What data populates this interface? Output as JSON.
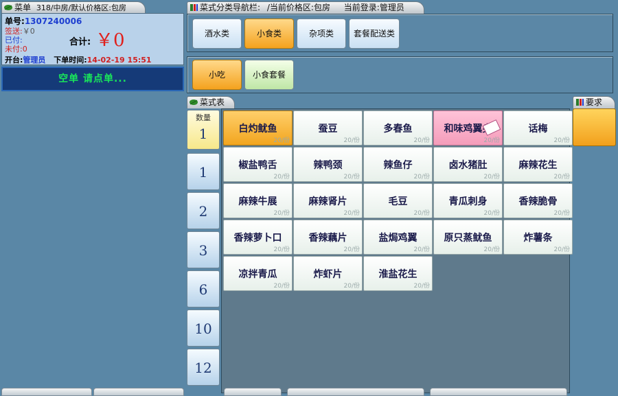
{
  "order_header": {
    "tab_label": "菜单",
    "room_info": "318/中房/默认价格区:包房"
  },
  "order_info": {
    "order_no_label": "单号:",
    "order_no": "1307240006",
    "sign_label": "签送:",
    "sign_value": "￥0",
    "paid_label": "已付:",
    "unpaid_label": "未付:",
    "unpaid_value": "0",
    "total_label": "合计:",
    "total_value": "￥0",
    "open_label": "开台:",
    "open_user": "管理员",
    "order_time_label": "下单时间:",
    "order_time": "14-02-19 15:51"
  },
  "status_message": "空单 请点单...",
  "nav": {
    "tab_label": "菜式分类导航栏:",
    "price_zone": "/当前价格区:包房",
    "login_label": "当前登录:管理员"
  },
  "categories": [
    {
      "label": "酒水类",
      "active": false
    },
    {
      "label": "小食类",
      "active": true
    },
    {
      "label": "杂项类",
      "active": false
    },
    {
      "label": "套餐配送类",
      "active": false
    }
  ],
  "subcategories": [
    {
      "label": "小吃",
      "active": true
    },
    {
      "label": "小食套餐",
      "active": false
    }
  ],
  "menu_tab_label": "菜式表",
  "requirements_tab_label": "要求",
  "qty_header": "数量",
  "quantities": [
    "1",
    "1",
    "2",
    "3",
    "6",
    "10",
    "12"
  ],
  "dishes": [
    {
      "name": "白灼鱿鱼",
      "price": "20/份",
      "state": "active"
    },
    {
      "name": "蚕豆",
      "price": "20/份",
      "state": ""
    },
    {
      "name": "多春鱼",
      "price": "20/份",
      "state": ""
    },
    {
      "name": "和味鸡翼尖",
      "price": "20/份",
      "state": "pink"
    },
    {
      "name": "话梅",
      "price": "20/份",
      "state": ""
    },
    {
      "name": "椒盐鸭舌",
      "price": "20/份",
      "state": ""
    },
    {
      "name": "辣鸭颈",
      "price": "20/份",
      "state": ""
    },
    {
      "name": "辣鱼仔",
      "price": "20/份",
      "state": ""
    },
    {
      "name": "卤水猪肚",
      "price": "20/份",
      "state": ""
    },
    {
      "name": "麻辣花生",
      "price": "20/份",
      "state": ""
    },
    {
      "name": "麻辣牛展",
      "price": "20/份",
      "state": ""
    },
    {
      "name": "麻辣肾片",
      "price": "20/份",
      "state": ""
    },
    {
      "name": "毛豆",
      "price": "20/份",
      "state": ""
    },
    {
      "name": "青瓜刺身",
      "price": "20/份",
      "state": ""
    },
    {
      "name": "香辣脆骨",
      "price": "20/份",
      "state": ""
    },
    {
      "name": "香辣萝卜口",
      "price": "20/份",
      "state": ""
    },
    {
      "name": "香辣藕片",
      "price": "20/份",
      "state": ""
    },
    {
      "name": "盐焗鸡翼",
      "price": "20/份",
      "state": ""
    },
    {
      "name": "原只蒸鱿鱼",
      "price": "20/份",
      "state": ""
    },
    {
      "name": "炸薯条",
      "price": "20/份",
      "state": ""
    },
    {
      "name": "凉拌青瓜",
      "price": "20/份",
      "state": ""
    },
    {
      "name": "炸虾片",
      "price": "20/份",
      "state": ""
    },
    {
      "name": "淮盐花生",
      "price": "20/份",
      "state": ""
    }
  ],
  "colors": {
    "background": "#5a87a6",
    "accent_orange": "#f4a21e",
    "status_green": "#19e65a",
    "total_red": "#e0201c",
    "pink": "#f49cba"
  }
}
